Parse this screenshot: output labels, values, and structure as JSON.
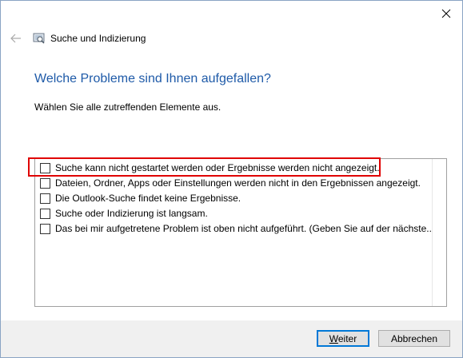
{
  "window": {
    "title": "Suche und Indizierung"
  },
  "content": {
    "heading": "Welche Probleme sind Ihnen aufgefallen?",
    "instruction": "Wählen Sie alle zutreffenden Elemente aus.",
    "options": [
      {
        "label": "Suche kann nicht gestartet werden oder Ergebnisse werden nicht angezeigt.",
        "checked": false
      },
      {
        "label": "Dateien, Ordner, Apps oder Einstellungen werden nicht in den Ergebnissen angezeigt.",
        "checked": false
      },
      {
        "label": "Die Outlook-Suche findet keine Ergebnisse.",
        "checked": false
      },
      {
        "label": "Suche oder Indizierung ist langsam.",
        "checked": false
      },
      {
        "label": "Das bei mir aufgetretene Problem ist oben nicht aufgeführt. (Geben Sie auf der nächste...",
        "checked": false
      }
    ]
  },
  "footer": {
    "next_label": "Weiter",
    "cancel_label": "Abbrechen"
  },
  "colors": {
    "heading": "#1e5aa8",
    "highlight": "#e00000",
    "accent": "#0078d7"
  },
  "icons": {
    "close": "close-icon",
    "back": "back-arrow-icon",
    "app": "search-indexing-icon"
  }
}
